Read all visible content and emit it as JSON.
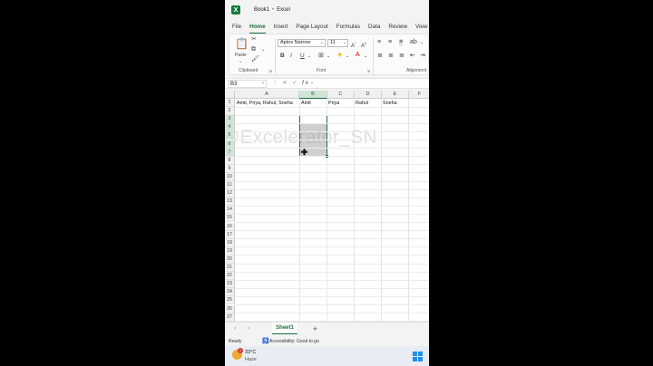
{
  "window": {
    "doc_title": "Book1",
    "separator": "•",
    "app_name": "Excel"
  },
  "tabs": [
    "File",
    "Home",
    "Insert",
    "Page Layout",
    "Formulas",
    "Data",
    "Review",
    "View"
  ],
  "ribbon": {
    "paste_label": "Paste",
    "clipboard_label": "Clipboard",
    "font_label": "Font",
    "alignment_label": "Alignment",
    "font_name": "Aptos Narrow",
    "font_size": "11"
  },
  "formula_bar": {
    "name_box": "B3",
    "formula": ""
  },
  "columns": [
    "A",
    "B",
    "C",
    "D",
    "E",
    "F"
  ],
  "rows": [
    "1",
    "2",
    "3",
    "4",
    "5",
    "6",
    "7",
    "8",
    "9",
    "10",
    "11",
    "12",
    "13",
    "14",
    "15",
    "16",
    "17",
    "18",
    "19",
    "20",
    "21",
    "22",
    "23",
    "24",
    "25",
    "26",
    "27"
  ],
  "cells": {
    "A1": "Amit, Priya, Rahul, Sneha",
    "B1": "Amit",
    "C1": "Priya",
    "D1": "Rahul",
    "E1": "Sneha"
  },
  "watermark": "@Excelerator_SN",
  "sheet": {
    "name": "Sheet1"
  },
  "status": {
    "ready": "Ready",
    "accessibility": "Accessibility: Good to go"
  },
  "taskbar": {
    "temp": "33°C",
    "condition": "Haze",
    "badge": "1"
  },
  "colors": {
    "accent": "#1e6e3f",
    "selection_fill": "#d0d0d0",
    "excel_green": "#107c41"
  }
}
